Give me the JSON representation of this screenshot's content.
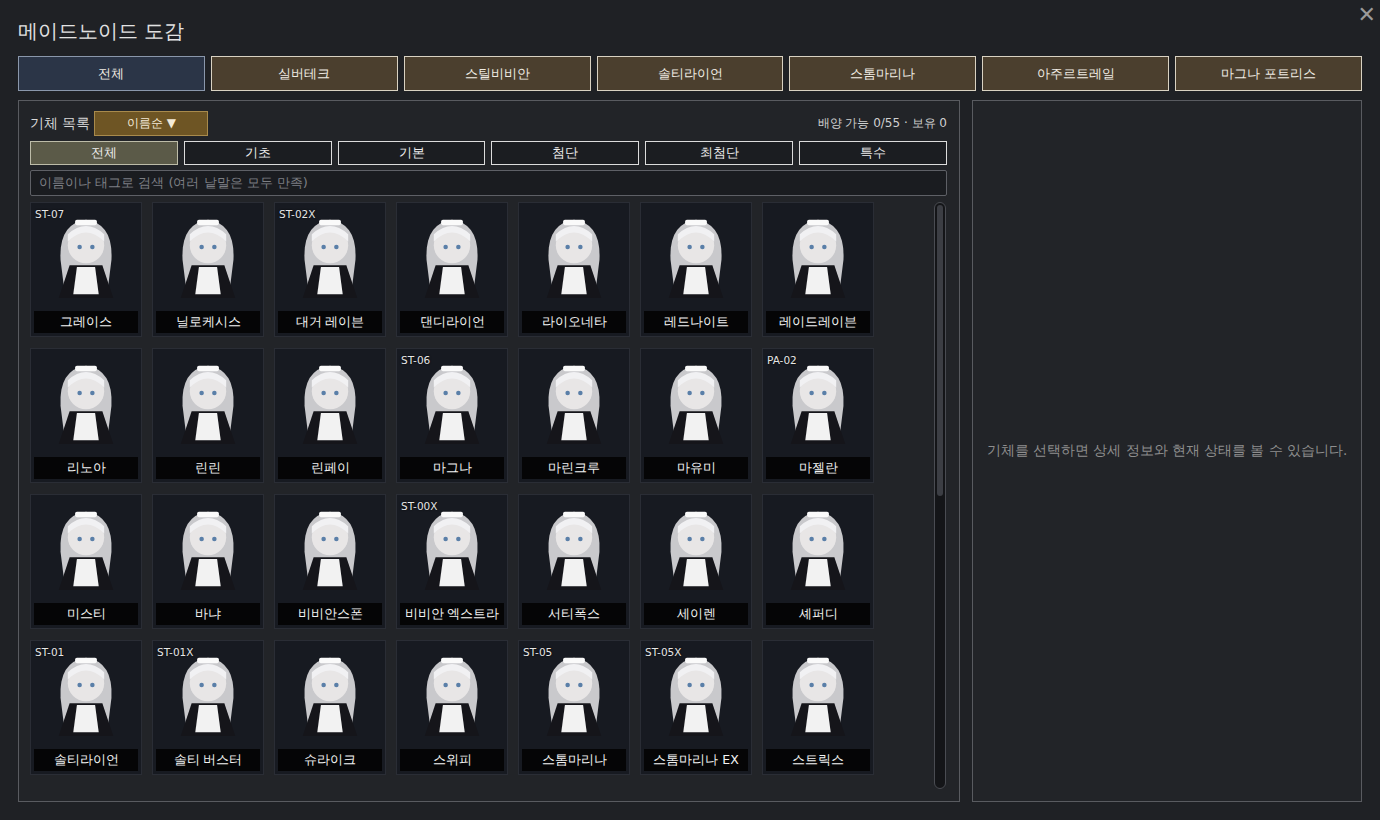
{
  "window": {
    "title": "메이드노이드 도감",
    "close": "✕"
  },
  "faction_tabs": [
    {
      "label": "전체",
      "selected": true
    },
    {
      "label": "실버테크",
      "selected": false
    },
    {
      "label": "스틸비비안",
      "selected": false
    },
    {
      "label": "솔티라이언",
      "selected": false
    },
    {
      "label": "스톰마리나",
      "selected": false
    },
    {
      "label": "아주르트레일",
      "selected": false
    },
    {
      "label": "마그나 포트리스",
      "selected": false
    }
  ],
  "list": {
    "label": "기체 목록",
    "sort": "이름순 ▼",
    "summary": "배양 가능 0/55 · 보유 0"
  },
  "tier_tabs": [
    {
      "label": "전체",
      "selected": true
    },
    {
      "label": "기초",
      "selected": false
    },
    {
      "label": "기본",
      "selected": false
    },
    {
      "label": "첨단",
      "selected": false
    },
    {
      "label": "최첨단",
      "selected": false
    },
    {
      "label": "특수",
      "selected": false
    }
  ],
  "search": {
    "placeholder": "이름이나 태그로 검색 (여러 낱말은 모두 만족)"
  },
  "cards": [
    {
      "name": "그레이스",
      "code": "ST-07"
    },
    {
      "name": "닐로케시스"
    },
    {
      "name": "대거 레이븐",
      "code": "ST-02X"
    },
    {
      "name": "댄디라이언"
    },
    {
      "name": "라이오네타"
    },
    {
      "name": "레드나이트"
    },
    {
      "name": "레이드레이븐"
    },
    {
      "name": "리노아"
    },
    {
      "name": "린린"
    },
    {
      "name": "린페이"
    },
    {
      "name": "마그나",
      "code": "ST-06"
    },
    {
      "name": "마린크루"
    },
    {
      "name": "마유미"
    },
    {
      "name": "마젤란",
      "code": "PA-02"
    },
    {
      "name": "미스티"
    },
    {
      "name": "바냐"
    },
    {
      "name": "비비안스폰"
    },
    {
      "name": "비비안 엑스트라",
      "code": "ST-00X"
    },
    {
      "name": "서티폭스"
    },
    {
      "name": "세이렌"
    },
    {
      "name": "셰퍼디"
    },
    {
      "name": "솔티라이언",
      "code": "ST-01"
    },
    {
      "name": "솔티 버스터",
      "code": "ST-01X"
    },
    {
      "name": "슈라이크"
    },
    {
      "name": "스위피"
    },
    {
      "name": "스톰마리나",
      "code": "ST-05"
    },
    {
      "name": "스톰마리나 EX",
      "code": "ST-05X"
    },
    {
      "name": "스트릭스"
    }
  ],
  "scrollbar": {
    "level": 0.5
  },
  "detail": {
    "hint": "기체를 선택하면 상세 정보와 현재 상태를 볼 수 있습니다."
  }
}
